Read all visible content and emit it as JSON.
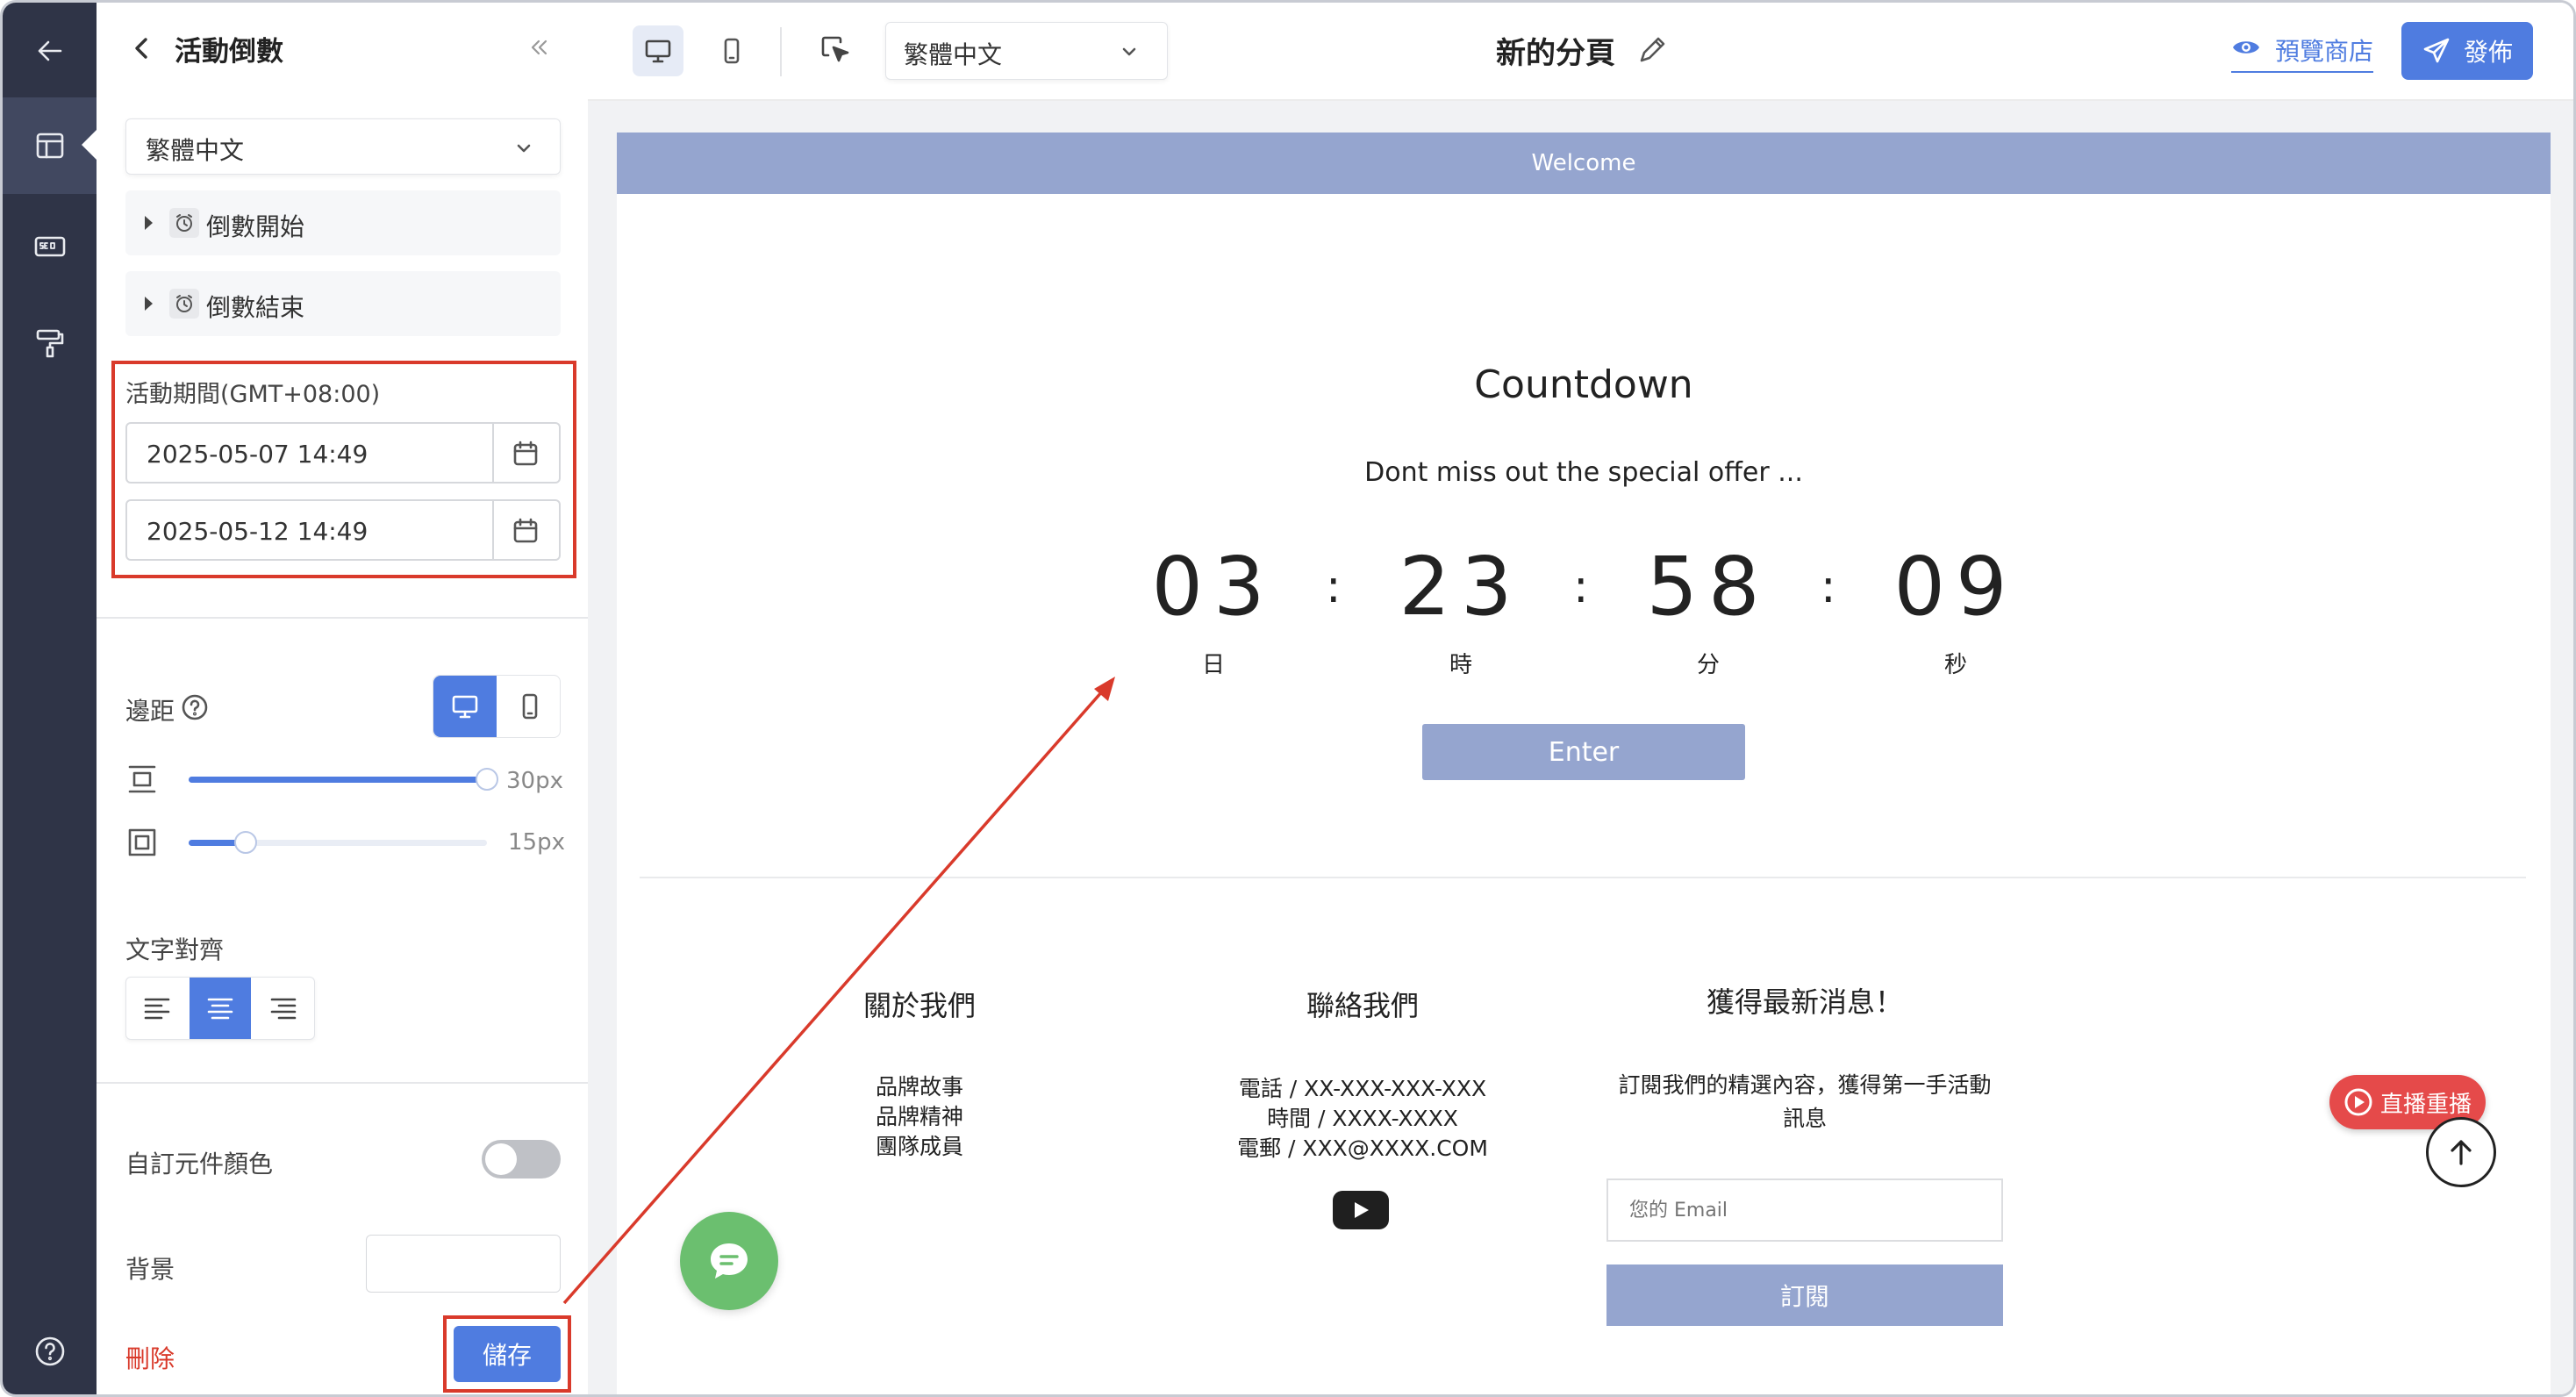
{
  "sidebar_panel": {
    "title": "活動倒數",
    "language": "繁體中文",
    "accordion": [
      {
        "label": "倒數開始"
      },
      {
        "label": "倒數結束"
      }
    ],
    "period_label": "活動期間(GMT+08:00)",
    "start_datetime": "2025-05-07 14:49",
    "end_datetime": "2025-05-12 14:49",
    "margin_label": "邊距",
    "vertical_margin": {
      "value": "30px",
      "fraction": 1.0
    },
    "horizontal_margin": {
      "value": "15px",
      "fraction": 0.19
    },
    "text_align_label": "文字對齊",
    "text_align_selected": "center",
    "custom_color_label": "自訂元件顏色",
    "custom_color_on": false,
    "background_label": "背景",
    "delete_label": "刪除",
    "save_label": "儲存"
  },
  "topbar": {
    "language": "繁體中文",
    "page_title": "新的分頁",
    "preview_label": "預覽商店",
    "publish_label": "發佈"
  },
  "preview": {
    "banner": "Welcome",
    "heading": "Countdown",
    "subtitle": "Dont miss out the special offer ...",
    "countdown": [
      {
        "value": "03",
        "unit": "日"
      },
      {
        "value": "23",
        "unit": "時"
      },
      {
        "value": "58",
        "unit": "分"
      },
      {
        "value": "09",
        "unit": "秒"
      }
    ],
    "enter_label": "Enter",
    "footer": {
      "about": {
        "title": "關於我們",
        "links": [
          "品牌故事",
          "品牌精神",
          "團隊成員"
        ]
      },
      "contact": {
        "title": "聯絡我們",
        "lines": [
          "電話 / XX-XXX-XXX-XXX",
          "時間 / XXXX-XXXX",
          "電郵 / XXX@XXXX.COM"
        ]
      },
      "news": {
        "title": "獲得最新消息！",
        "desc_line1": "訂閱我們的精選內容，獲得第一手活動",
        "desc_line2": "訊息",
        "email_placeholder": "您的 Email",
        "subscribe_label": "訂閱"
      }
    },
    "live_replay_label": "直播重播"
  },
  "colors": {
    "accent": "#4f7ce0",
    "banner": "#95a5cf",
    "highlight": "#d93a2b",
    "rail": "#2f3447",
    "chat": "#6bbf6f"
  }
}
